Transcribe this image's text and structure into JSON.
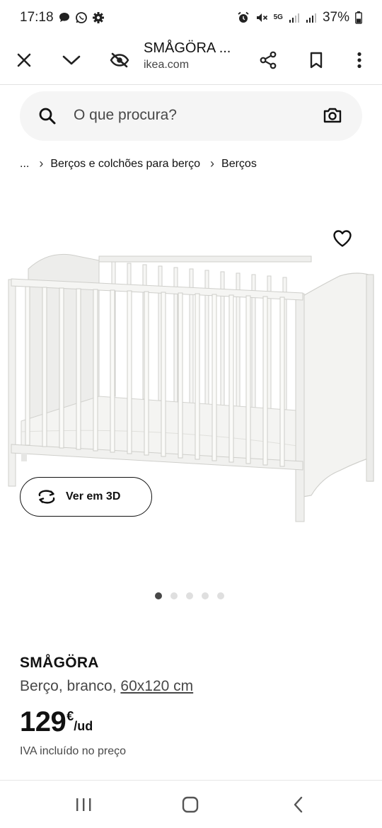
{
  "status_bar": {
    "time": "17:18",
    "network": "5G",
    "battery": "37%"
  },
  "tab_bar": {
    "title": "SMÅGÖRA ...",
    "url": "ikea.com"
  },
  "search": {
    "placeholder": "O que procura?"
  },
  "breadcrumb": {
    "ellipsis": "...",
    "items": [
      "Berços e colchões para berço",
      "Berços"
    ]
  },
  "gallery": {
    "view_3d_label": "Ver em 3D",
    "image_count": 5,
    "active_index": 0
  },
  "product": {
    "name": "SMÅGÖRA",
    "description": "Berço, branco,",
    "dimensions": "60x120 cm",
    "price_integer": "129",
    "currency": "€",
    "unit": "/ud",
    "vat_note": "IVA incluído no preço"
  },
  "colors": {
    "search_bg": "#f5f5f5",
    "text_primary": "#111111",
    "text_secondary": "#484848",
    "dot_active": "#484848",
    "dot_inactive": "#dfdfdf"
  }
}
